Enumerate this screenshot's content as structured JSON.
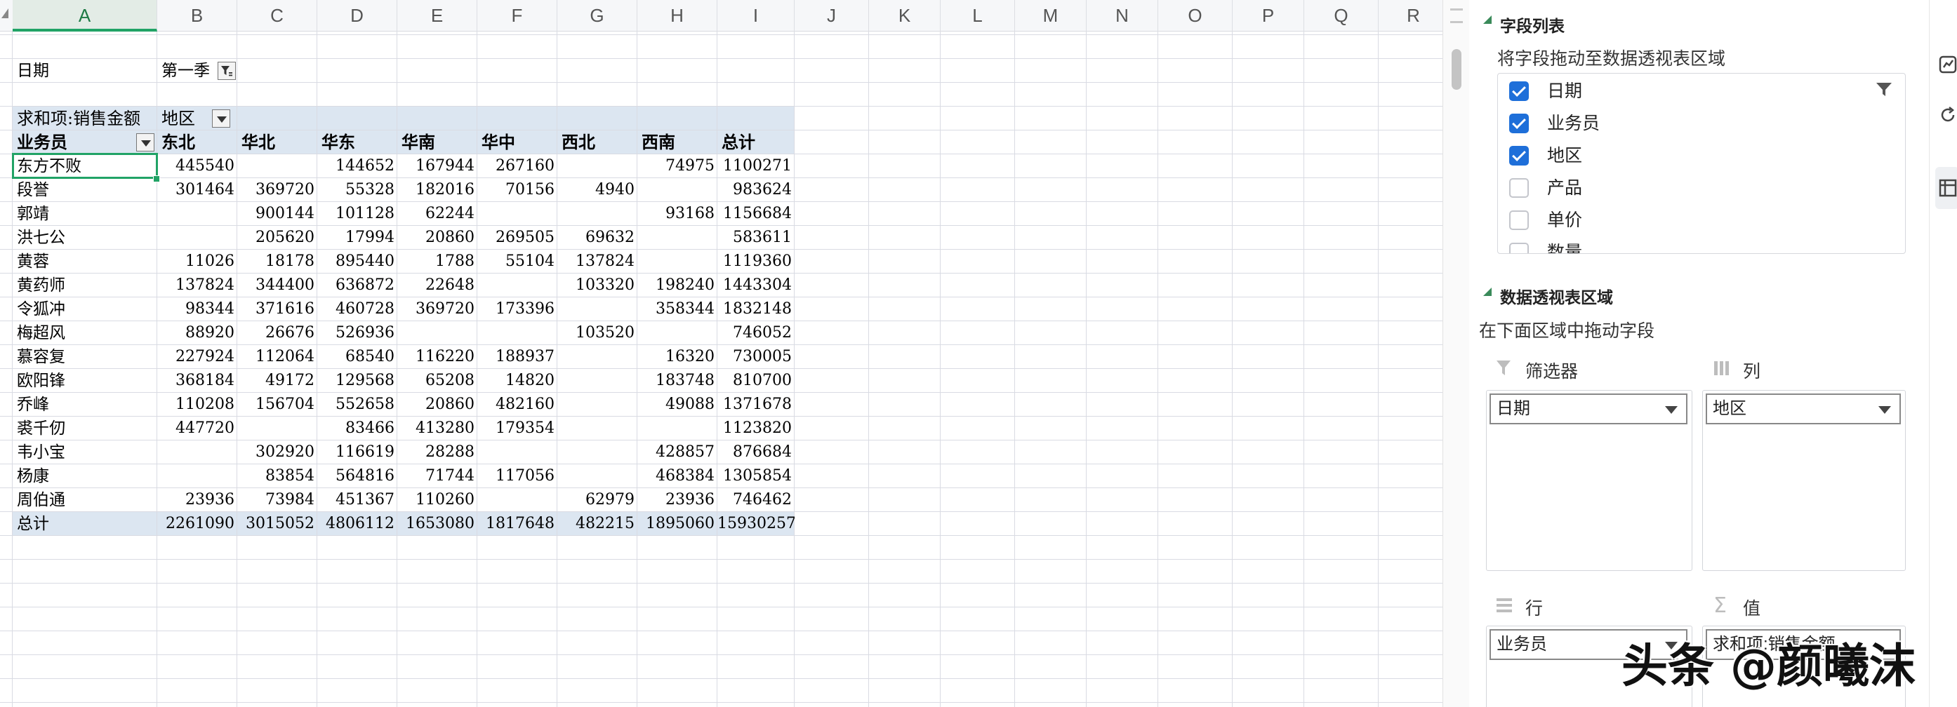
{
  "columns": [
    "A",
    "B",
    "C",
    "D",
    "E",
    "F",
    "G",
    "H",
    "I",
    "J",
    "K",
    "L",
    "M",
    "N",
    "O",
    "P",
    "Q",
    "R"
  ],
  "filter": {
    "label": "日期",
    "value": "第一季"
  },
  "pivot": {
    "value_label": "求和项:销售金额",
    "col_field": "地区",
    "row_field": "业务员",
    "col_headers": [
      "东北",
      "华北",
      "华东",
      "华南",
      "华中",
      "西北",
      "西南",
      "总计"
    ],
    "rows": [
      {
        "name": "东方不败",
        "values": [
          "445540",
          "",
          "144652",
          "167944",
          "267160",
          "",
          "74975",
          "1100271"
        ]
      },
      {
        "name": "段誉",
        "values": [
          "301464",
          "369720",
          "55328",
          "182016",
          "70156",
          "4940",
          "",
          "983624"
        ]
      },
      {
        "name": "郭靖",
        "values": [
          "",
          "900144",
          "101128",
          "62244",
          "",
          "",
          "93168",
          "1156684"
        ]
      },
      {
        "name": "洪七公",
        "values": [
          "",
          "205620",
          "17994",
          "20860",
          "269505",
          "69632",
          "",
          "583611"
        ]
      },
      {
        "name": "黄蓉",
        "values": [
          "11026",
          "18178",
          "895440",
          "1788",
          "55104",
          "137824",
          "",
          "1119360"
        ]
      },
      {
        "name": "黄药师",
        "values": [
          "137824",
          "344400",
          "636872",
          "22648",
          "",
          "103320",
          "198240",
          "1443304"
        ]
      },
      {
        "name": "令狐冲",
        "values": [
          "98344",
          "371616",
          "460728",
          "369720",
          "173396",
          "",
          "358344",
          "1832148"
        ]
      },
      {
        "name": "梅超风",
        "values": [
          "88920",
          "26676",
          "526936",
          "",
          "",
          "103520",
          "",
          "746052"
        ]
      },
      {
        "name": "慕容复",
        "values": [
          "227924",
          "112064",
          "68540",
          "116220",
          "188937",
          "",
          "16320",
          "730005"
        ]
      },
      {
        "name": "欧阳锋",
        "values": [
          "368184",
          "49172",
          "129568",
          "65208",
          "14820",
          "",
          "183748",
          "810700"
        ]
      },
      {
        "name": "乔峰",
        "values": [
          "110208",
          "156704",
          "552658",
          "20860",
          "482160",
          "",
          "49088",
          "1371678"
        ]
      },
      {
        "name": "裘千仞",
        "values": [
          "447720",
          "",
          "83466",
          "413280",
          "179354",
          "",
          "",
          "1123820"
        ]
      },
      {
        "name": "韦小宝",
        "values": [
          "",
          "302920",
          "116619",
          "28288",
          "",
          "",
          "428857",
          "876684"
        ]
      },
      {
        "name": "杨康",
        "values": [
          "",
          "83854",
          "564816",
          "71744",
          "117056",
          "",
          "468384",
          "1305854"
        ]
      },
      {
        "name": "周伯通",
        "values": [
          "23936",
          "73984",
          "451367",
          "110260",
          "",
          "62979",
          "23936",
          "746462"
        ]
      }
    ],
    "total": {
      "name": "总计",
      "values": [
        "2261090",
        "3015052",
        "4806112",
        "1653080",
        "1817648",
        "482215",
        "1895060",
        "15930257"
      ]
    }
  },
  "pane": {
    "field_list_title": "字段列表",
    "field_list_hint": "将字段拖动至数据透视表区域",
    "fields": [
      {
        "label": "日期",
        "checked": true
      },
      {
        "label": "业务员",
        "checked": true
      },
      {
        "label": "地区",
        "checked": true
      },
      {
        "label": "产品",
        "checked": false
      },
      {
        "label": "单价",
        "checked": false
      },
      {
        "label": "数量",
        "checked": false
      }
    ],
    "area_title": "数据透视表区域",
    "area_hint": "在下面区域中拖动字段",
    "zones": {
      "filter": {
        "label": "筛选器",
        "chip": "日期"
      },
      "columns": {
        "label": "列",
        "chip": "地区"
      },
      "rows": {
        "label": "行",
        "chip": "业务员"
      },
      "values": {
        "label": "值",
        "chip": "求和项:销售金额"
      }
    }
  },
  "watermark": "头条 @颜曦沫",
  "colors": {
    "accent": "#21a366",
    "pivot_band": "#dce6f1",
    "checkbox": "#1e6fd9"
  }
}
